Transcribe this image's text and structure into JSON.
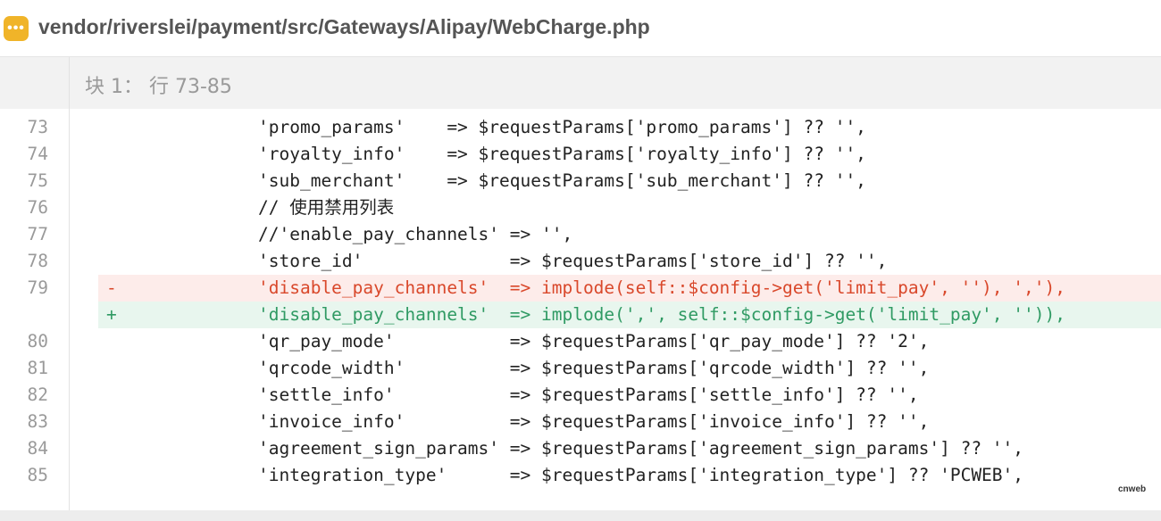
{
  "header": {
    "icon": "ellipsis-icon",
    "icon_color": "#f0b429",
    "file_path": "vendor/riverslei/payment/src/Gateways/Alipay/WebCharge.php"
  },
  "hunk": {
    "label": "块 1： 行 73-85"
  },
  "lines": [
    {
      "type": "ctx",
      "num": "73",
      "code": "'promo_params'    => $requestParams['promo_params'] ?? '',"
    },
    {
      "type": "ctx",
      "num": "74",
      "code": "'royalty_info'    => $requestParams['royalty_info'] ?? '',"
    },
    {
      "type": "ctx",
      "num": "75",
      "code": "'sub_merchant'    => $requestParams['sub_merchant'] ?? '',"
    },
    {
      "type": "ctx",
      "num": "76",
      "code": "// 使用禁用列表"
    },
    {
      "type": "ctx",
      "num": "77",
      "code": "//'enable_pay_channels' => '',"
    },
    {
      "type": "ctx",
      "num": "78",
      "code": "'store_id'              => $requestParams['store_id'] ?? '',"
    },
    {
      "type": "del",
      "num": "79",
      "marker": "-",
      "code": "'disable_pay_channels'  => implode(self::$config->get('limit_pay', ''), ','),"
    },
    {
      "type": "add",
      "num": "",
      "marker": "+",
      "code": "'disable_pay_channels'  => implode(',', self::$config->get('limit_pay', '')),"
    },
    {
      "type": "ctx",
      "num": "80",
      "code": "'qr_pay_mode'           => $requestParams['qr_pay_mode'] ?? '2',"
    },
    {
      "type": "ctx",
      "num": "81",
      "code": "'qrcode_width'          => $requestParams['qrcode_width'] ?? '',"
    },
    {
      "type": "ctx",
      "num": "82",
      "code": "'settle_info'           => $requestParams['settle_info'] ?? '',"
    },
    {
      "type": "ctx",
      "num": "83",
      "code": "'invoice_info'          => $requestParams['invoice_info'] ?? '',"
    },
    {
      "type": "ctx",
      "num": "84",
      "code": "'agreement_sign_params' => $requestParams['agreement_sign_params'] ?? '',"
    },
    {
      "type": "ctx",
      "num": "85",
      "code": "'integration_type'      => $requestParams['integration_type'] ?? 'PCWEB',"
    }
  ],
  "colors": {
    "deleted_text": "#d9482b",
    "deleted_bg": "#fdecea",
    "added_text": "#2f9a63",
    "added_bg": "#e8f6ee"
  },
  "watermark": "cnweb"
}
